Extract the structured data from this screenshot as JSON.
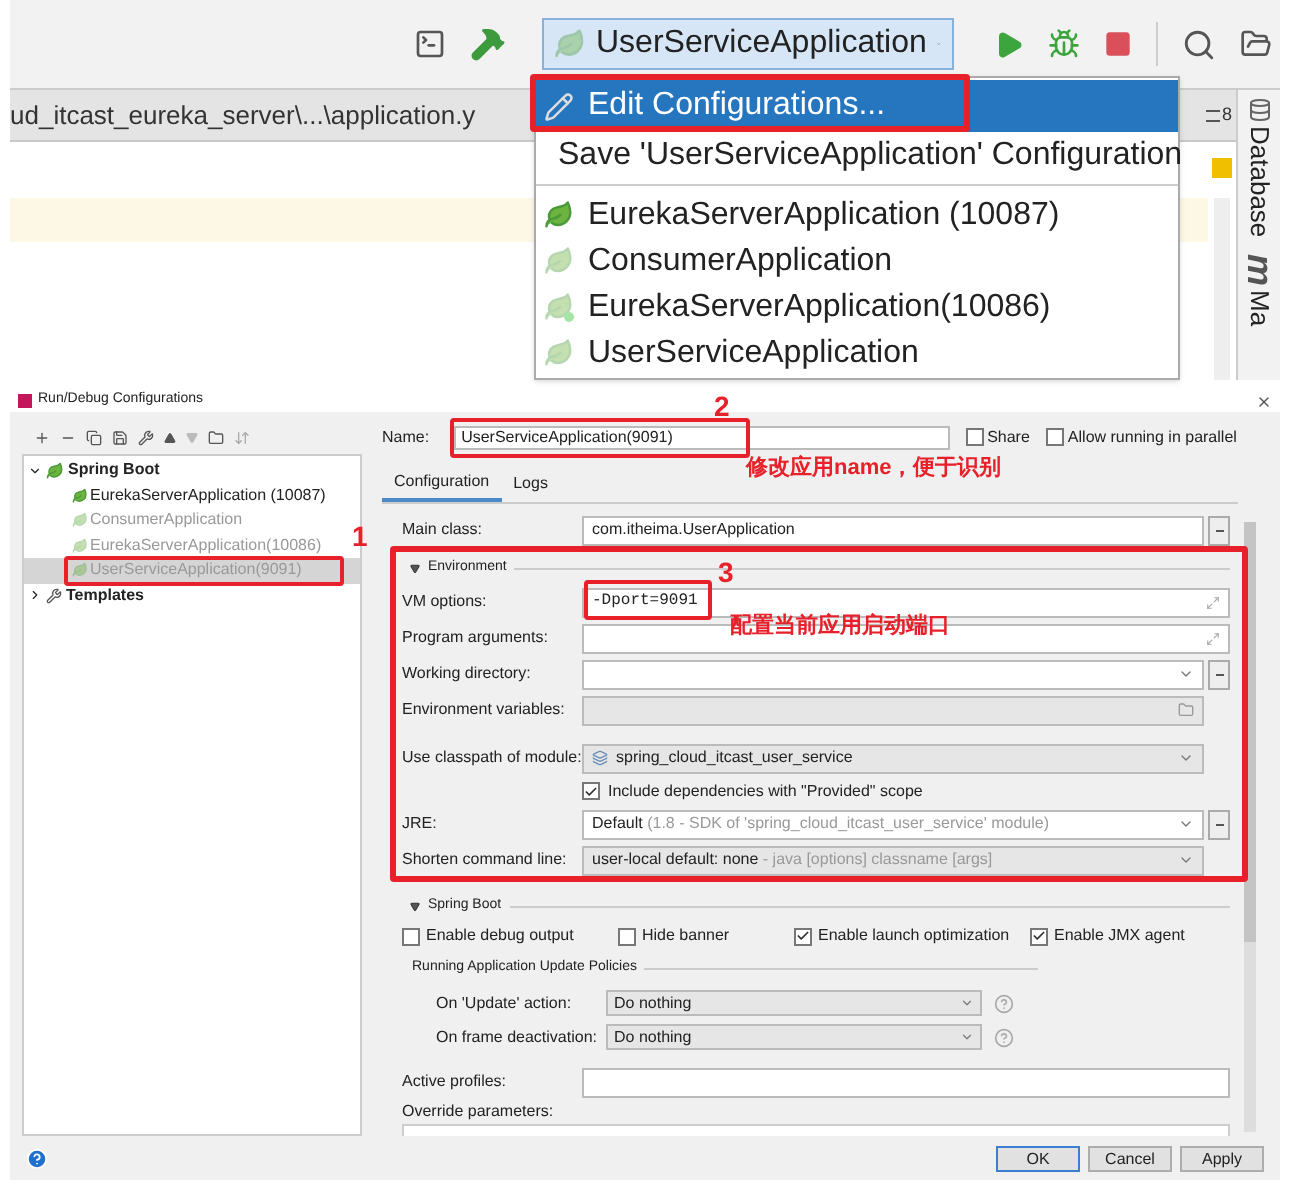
{
  "toolbar": {
    "run_config": "UserServiceApplication"
  },
  "editor": {
    "breadcrumb": "ud_itcast_eureka_server\\...\\application.y",
    "tab_count": "8"
  },
  "side_tabs": [
    {
      "label": "Database"
    },
    {
      "label": "m"
    },
    {
      "label": "Ma"
    }
  ],
  "run_menu": {
    "items": [
      {
        "kind": "action",
        "label": "Edit Configurations...",
        "selected": true
      },
      {
        "kind": "action",
        "label": "Save 'UserServiceApplication' Configuration",
        "selected": false
      },
      {
        "kind": "config",
        "label": "EurekaServerApplication (10087)",
        "selected": false,
        "active": true,
        "running": false
      },
      {
        "kind": "config",
        "label": "ConsumerApplication",
        "selected": false,
        "active": false,
        "running": false
      },
      {
        "kind": "config",
        "label": "EurekaServerApplication(10086)",
        "selected": false,
        "active": false,
        "running": true
      },
      {
        "kind": "config",
        "label": "UserServiceApplication",
        "selected": false,
        "active": false,
        "running": false
      }
    ]
  },
  "dialog": {
    "title": "Run/Debug Configurations",
    "tree": [
      {
        "label": "Spring Boot",
        "expanded": true,
        "children": [
          {
            "label": "EurekaServerApplication (10087)",
            "active": true,
            "selected": false
          },
          {
            "label": "ConsumerApplication",
            "active": false,
            "selected": false
          },
          {
            "label": "EurekaServerApplication(10086)",
            "active": false,
            "selected": false
          },
          {
            "label": "UserServiceApplication(9091)",
            "active": false,
            "selected": true
          }
        ]
      },
      {
        "label": "Templates",
        "expanded": false
      }
    ],
    "name_label": "Name:",
    "name": "UserServiceApplication(9091)",
    "options": [
      {
        "label": "Share",
        "checked": false
      },
      {
        "label": "Allow running in parallel",
        "checked": false
      }
    ],
    "tabs": [
      {
        "label": "Configuration",
        "selected": true
      },
      {
        "label": "Logs",
        "selected": false
      }
    ],
    "main_class": {
      "label": "Main class:",
      "value": "com.itheima.UserApplication"
    },
    "environment": {
      "title": "Environment",
      "expanded": true,
      "rows": [
        {
          "kind": "expandable",
          "label": "VM options:",
          "value": "-Dport=9091"
        },
        {
          "kind": "expandable",
          "label": "Program arguments:"
        },
        {
          "kind": "combo",
          "label": "Working directory:"
        },
        {
          "kind": "env",
          "label": "Environment variables:"
        },
        {
          "kind": "module",
          "label": "Use classpath of module:",
          "value": "spring_cloud_itcast_user_service"
        },
        {
          "kind": "checkbox",
          "label": "Include dependencies with \"Provided\" scope",
          "checked": true
        },
        {
          "kind": "jre",
          "label": "JRE:",
          "value": "Default",
          "hint": "(1.8 - SDK of 'spring_cloud_itcast_user_service' module)"
        },
        {
          "kind": "shorten",
          "label": "Shorten command line:",
          "value": "user-local default: none",
          "hint": "- java [options] classname [args]"
        }
      ]
    },
    "spring_boot": {
      "title": "Spring Boot",
      "expanded": true,
      "checkboxes": [
        {
          "label": "Enable debug output",
          "checked": false
        },
        {
          "label": "Hide banner",
          "checked": false
        },
        {
          "label": "Enable launch optimization",
          "checked": true
        },
        {
          "label": "Enable JMX agent",
          "checked": true
        }
      ],
      "policies_title": "Running Application Update Policies",
      "policies": [
        {
          "label": "On 'Update' action:",
          "value": "Do nothing"
        },
        {
          "label": "On frame deactivation:",
          "value": "Do nothing"
        }
      ],
      "active_profiles": "Active profiles:",
      "override": "Override parameters:"
    },
    "buttons": [
      {
        "label": "OK",
        "selected": true
      },
      {
        "label": "Cancel",
        "selected": false
      },
      {
        "label": "Apply",
        "selected": false
      }
    ]
  },
  "annotations": {
    "markers": [
      "1",
      "2",
      "3"
    ],
    "notes": [
      "修改应用name，便于识别",
      "配置当前应用启动端口"
    ]
  }
}
